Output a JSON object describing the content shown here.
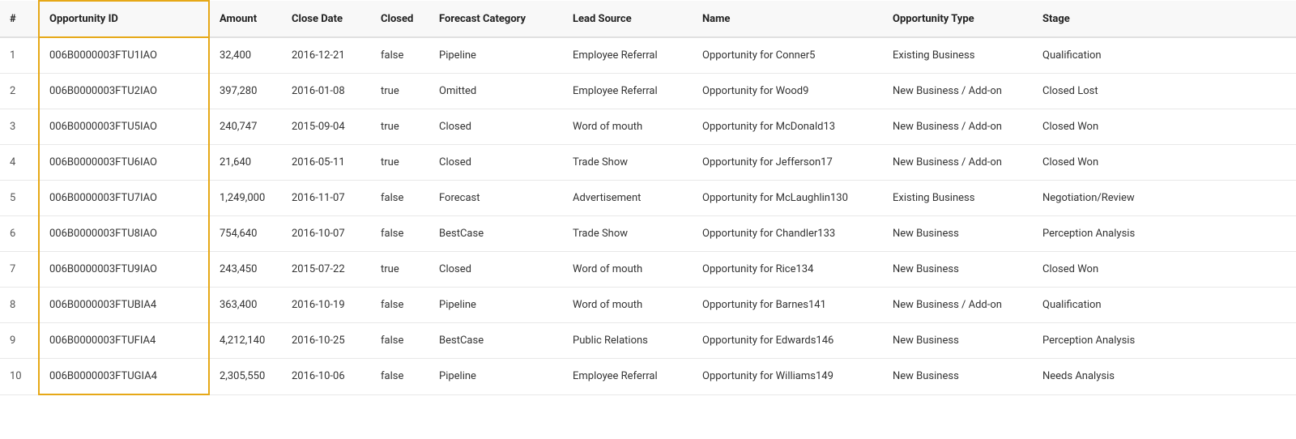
{
  "table": {
    "columns": [
      {
        "key": "num",
        "label": "#"
      },
      {
        "key": "opportunity_id",
        "label": "Opportunity ID"
      },
      {
        "key": "amount",
        "label": "Amount"
      },
      {
        "key": "close_date",
        "label": "Close Date"
      },
      {
        "key": "closed",
        "label": "Closed"
      },
      {
        "key": "forecast_category",
        "label": "Forecast Category"
      },
      {
        "key": "lead_source",
        "label": "Lead Source"
      },
      {
        "key": "name",
        "label": "Name"
      },
      {
        "key": "opportunity_type",
        "label": "Opportunity Type"
      },
      {
        "key": "stage",
        "label": "Stage"
      }
    ],
    "rows": [
      {
        "num": "1",
        "opportunity_id": "006B0000003FTU1IAO",
        "amount": "32,400",
        "close_date": "2016-12-21",
        "closed": "false",
        "forecast_category": "Pipeline",
        "lead_source": "Employee Referral",
        "name": "Opportunity for Conner5",
        "opportunity_type": "Existing Business",
        "stage": "Qualification"
      },
      {
        "num": "2",
        "opportunity_id": "006B0000003FTU2IAO",
        "amount": "397,280",
        "close_date": "2016-01-08",
        "closed": "true",
        "forecast_category": "Omitted",
        "lead_source": "Employee Referral",
        "name": "Opportunity for Wood9",
        "opportunity_type": "New Business / Add-on",
        "stage": "Closed Lost"
      },
      {
        "num": "3",
        "opportunity_id": "006B0000003FTU5IAO",
        "amount": "240,747",
        "close_date": "2015-09-04",
        "closed": "true",
        "forecast_category": "Closed",
        "lead_source": "Word of mouth",
        "name": "Opportunity for McDonald13",
        "opportunity_type": "New Business / Add-on",
        "stage": "Closed Won"
      },
      {
        "num": "4",
        "opportunity_id": "006B0000003FTU6IAO",
        "amount": "21,640",
        "close_date": "2016-05-11",
        "closed": "true",
        "forecast_category": "Closed",
        "lead_source": "Trade Show",
        "name": "Opportunity for Jefferson17",
        "opportunity_type": "New Business / Add-on",
        "stage": "Closed Won"
      },
      {
        "num": "5",
        "opportunity_id": "006B0000003FTU7IAO",
        "amount": "1,249,000",
        "close_date": "2016-11-07",
        "closed": "false",
        "forecast_category": "Forecast",
        "lead_source": "Advertisement",
        "name": "Opportunity for McLaughlin130",
        "opportunity_type": "Existing Business",
        "stage": "Negotiation/Review"
      },
      {
        "num": "6",
        "opportunity_id": "006B0000003FTU8IAO",
        "amount": "754,640",
        "close_date": "2016-10-07",
        "closed": "false",
        "forecast_category": "BestCase",
        "lead_source": "Trade Show",
        "name": "Opportunity for Chandler133",
        "opportunity_type": "New Business",
        "stage": "Perception Analysis"
      },
      {
        "num": "7",
        "opportunity_id": "006B0000003FTU9IAO",
        "amount": "243,450",
        "close_date": "2015-07-22",
        "closed": "true",
        "forecast_category": "Closed",
        "lead_source": "Word of mouth",
        "name": "Opportunity for Rice134",
        "opportunity_type": "New Business",
        "stage": "Closed Won"
      },
      {
        "num": "8",
        "opportunity_id": "006B0000003FTUBIA4",
        "amount": "363,400",
        "close_date": "2016-10-19",
        "closed": "false",
        "forecast_category": "Pipeline",
        "lead_source": "Word of mouth",
        "name": "Opportunity for Barnes141",
        "opportunity_type": "New Business / Add-on",
        "stage": "Qualification"
      },
      {
        "num": "9",
        "opportunity_id": "006B0000003FTUFIA4",
        "amount": "4,212,140",
        "close_date": "2016-10-25",
        "closed": "false",
        "forecast_category": "BestCase",
        "lead_source": "Public Relations",
        "name": "Opportunity for Edwards146",
        "opportunity_type": "New Business",
        "stage": "Perception Analysis"
      },
      {
        "num": "10",
        "opportunity_id": "006B0000003FTUGIA4",
        "amount": "2,305,550",
        "close_date": "2016-10-06",
        "closed": "false",
        "forecast_category": "Pipeline",
        "lead_source": "Employee Referral",
        "name": "Opportunity for Williams149",
        "opportunity_type": "New Business",
        "stage": "Needs Analysis"
      }
    ]
  }
}
